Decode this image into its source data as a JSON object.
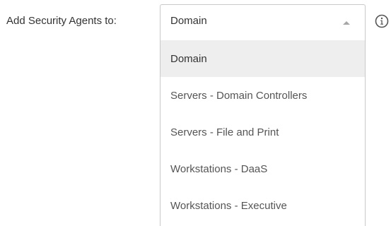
{
  "form": {
    "label": "Add Security Agents to:",
    "select": {
      "value": "Domain",
      "expanded": true,
      "options": [
        {
          "label": "Domain",
          "selected": true
        },
        {
          "label": "Servers - Domain Controllers",
          "selected": false
        },
        {
          "label": "Servers - File and Print",
          "selected": false
        },
        {
          "label": "Workstations - DaaS",
          "selected": false
        },
        {
          "label": "Workstations - Executive",
          "selected": false
        }
      ]
    },
    "info_icon": "info-circle-icon"
  },
  "colors": {
    "border": "#c9c9c9",
    "highlight": "#eeeeee",
    "text": "#333333",
    "option_text": "#555555",
    "arrow": "#a7a7a7",
    "icon": "#555555"
  }
}
